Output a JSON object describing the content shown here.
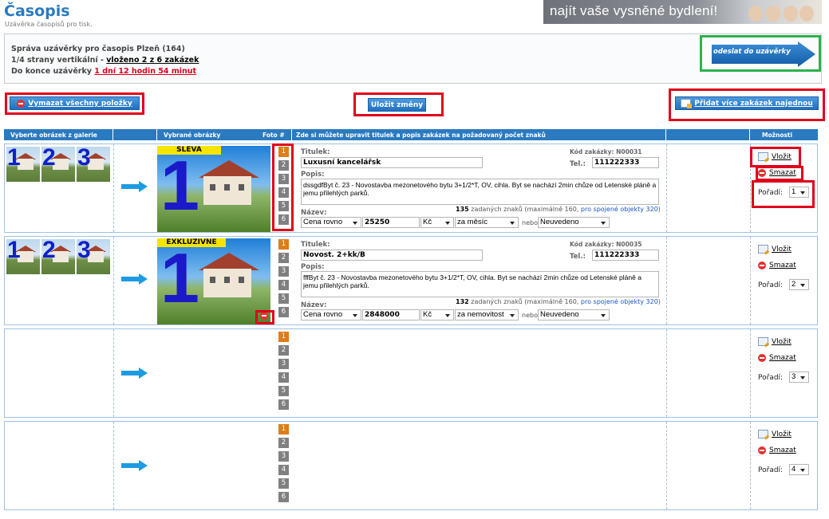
{
  "page": {
    "title": "Časopis",
    "subtitle": "Uzávěrka časopisů pro tisk."
  },
  "banner": {
    "text": "najít vaše vysněné bydlení!"
  },
  "info": {
    "line1": "Správa uzávěrky pro časopis Plzeň (164)",
    "line2_prefix": "1/4 strany vertikální - ",
    "line2_link": "vloženo 2 z 6 zakázek",
    "line3_prefix": "Do konce uzávěrky ",
    "line3_link": "1 dní 12 hodin 54 minut"
  },
  "send_button": {
    "label": "odeslat do uzávěrky"
  },
  "toolbar": {
    "clear_all": "Vymazat všechny položky",
    "save": "Uložit změny",
    "add_more": "Přidat více zakázek najednou"
  },
  "table_header": {
    "gallery": "Vyberte obrázek z galerie",
    "selected": "Vybrané obrázky",
    "foto": "Foto #",
    "edit": "Zde si můžete upravit titulek a popis zakázek na požadovaný počet znaků",
    "options": "Možnosti"
  },
  "foto_numbers": [
    "1",
    "2",
    "3",
    "4",
    "5",
    "6"
  ],
  "gallery_numbers": [
    "1",
    "2",
    "3"
  ],
  "labels": {
    "titulek": "Titulek:",
    "popis": "Popis:",
    "nazev": "Název:",
    "tel": "Tel.:",
    "vlozit": "Vložit",
    "smazat": "Smazat",
    "poradi": "Pořadí:",
    "nebo": "nebo",
    "chars_suffix": "zadaných znaků (maximálně 160, ",
    "chars_link": "pro spojené objekty 320",
    "chars_end": ")"
  },
  "rows": [
    {
      "tag": "SLEVA",
      "photo_num": "1",
      "selected_foto": 1,
      "kod_label": "Kód zakázky: N00031",
      "titulek": "Luxusní kancelářsk",
      "tel": "111222333",
      "popis": "dssgdfByt č. 23 - Novostavba mezonetového bytu 3+1/2*T, OV, cihla. Byt se nachází 2min chůze od Letenské pláně a jemu přilehlých parků.",
      "chars": "135",
      "price_type": "Cena rovno",
      "price": "25250",
      "currency": "Kč",
      "period": "za měsíc",
      "extra": "Neuvedeno",
      "poradi": "1"
    },
    {
      "tag": "EXKLUZIVNĚ",
      "photo_num": "1",
      "selected_foto": 1,
      "kod_label": "Kód zakázky: N00035",
      "titulek": "Novost. 2+kk/B",
      "tel": "111222333",
      "popis": "fffByt č. 23 - Novostavba mezonetového bytu 3+1/2*T, OV, cihla. Byt se nachází 2min chůze od Letenské pláně a jemu přilehlých parků.",
      "chars": "132",
      "price_type": "Cena rovno",
      "price": "2848000",
      "currency": "Kč",
      "period": "za nemovitost",
      "extra": "Neuvedeno",
      "poradi": "2"
    },
    {
      "poradi": "3"
    },
    {
      "poradi": "4"
    }
  ],
  "colors": {
    "accent_blue": "#2a7ac0",
    "highlight_red": "#e0001c",
    "highlight_green": "#2bb24c",
    "selected_orange": "#e07c1a"
  }
}
